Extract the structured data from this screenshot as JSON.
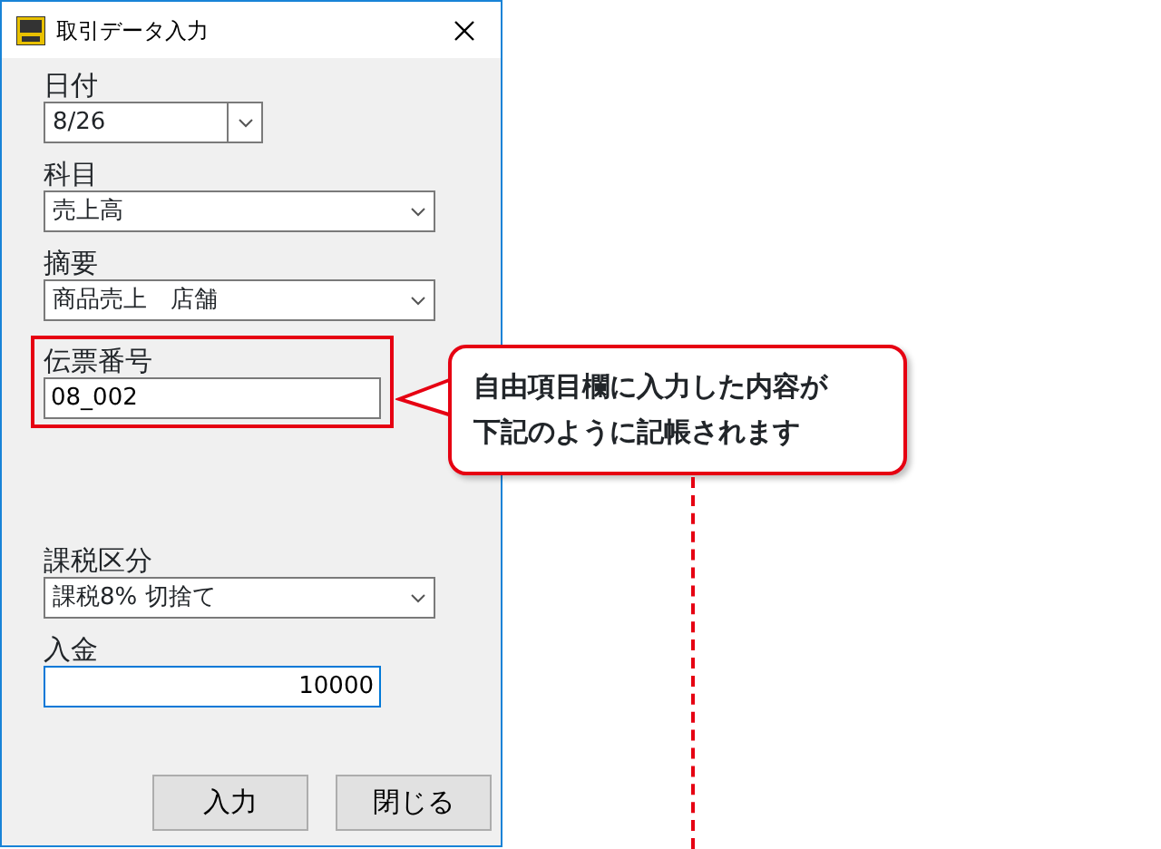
{
  "window": {
    "title": "取引データ入力"
  },
  "fields": [
    {
      "kind": "date",
      "label": "日付",
      "value": "8/26"
    },
    {
      "kind": "select",
      "label": "科目",
      "value": "売上高"
    },
    {
      "kind": "select",
      "label": "摘要",
      "value": "商品売上　店舗"
    },
    {
      "kind": "text",
      "label": "伝票番号",
      "value": "08_002",
      "highlighted": true
    },
    {
      "kind": "gap"
    },
    {
      "kind": "select",
      "label": "課税区分",
      "value": "課税8% 切捨て"
    },
    {
      "kind": "amount",
      "label": "入金",
      "value": "10000",
      "focused": true
    }
  ],
  "buttons": [
    "入力",
    "閉じる"
  ],
  "callout": {
    "lines": [
      "自由項目欄に入力した内容が",
      "下記のように記帳されます"
    ]
  }
}
